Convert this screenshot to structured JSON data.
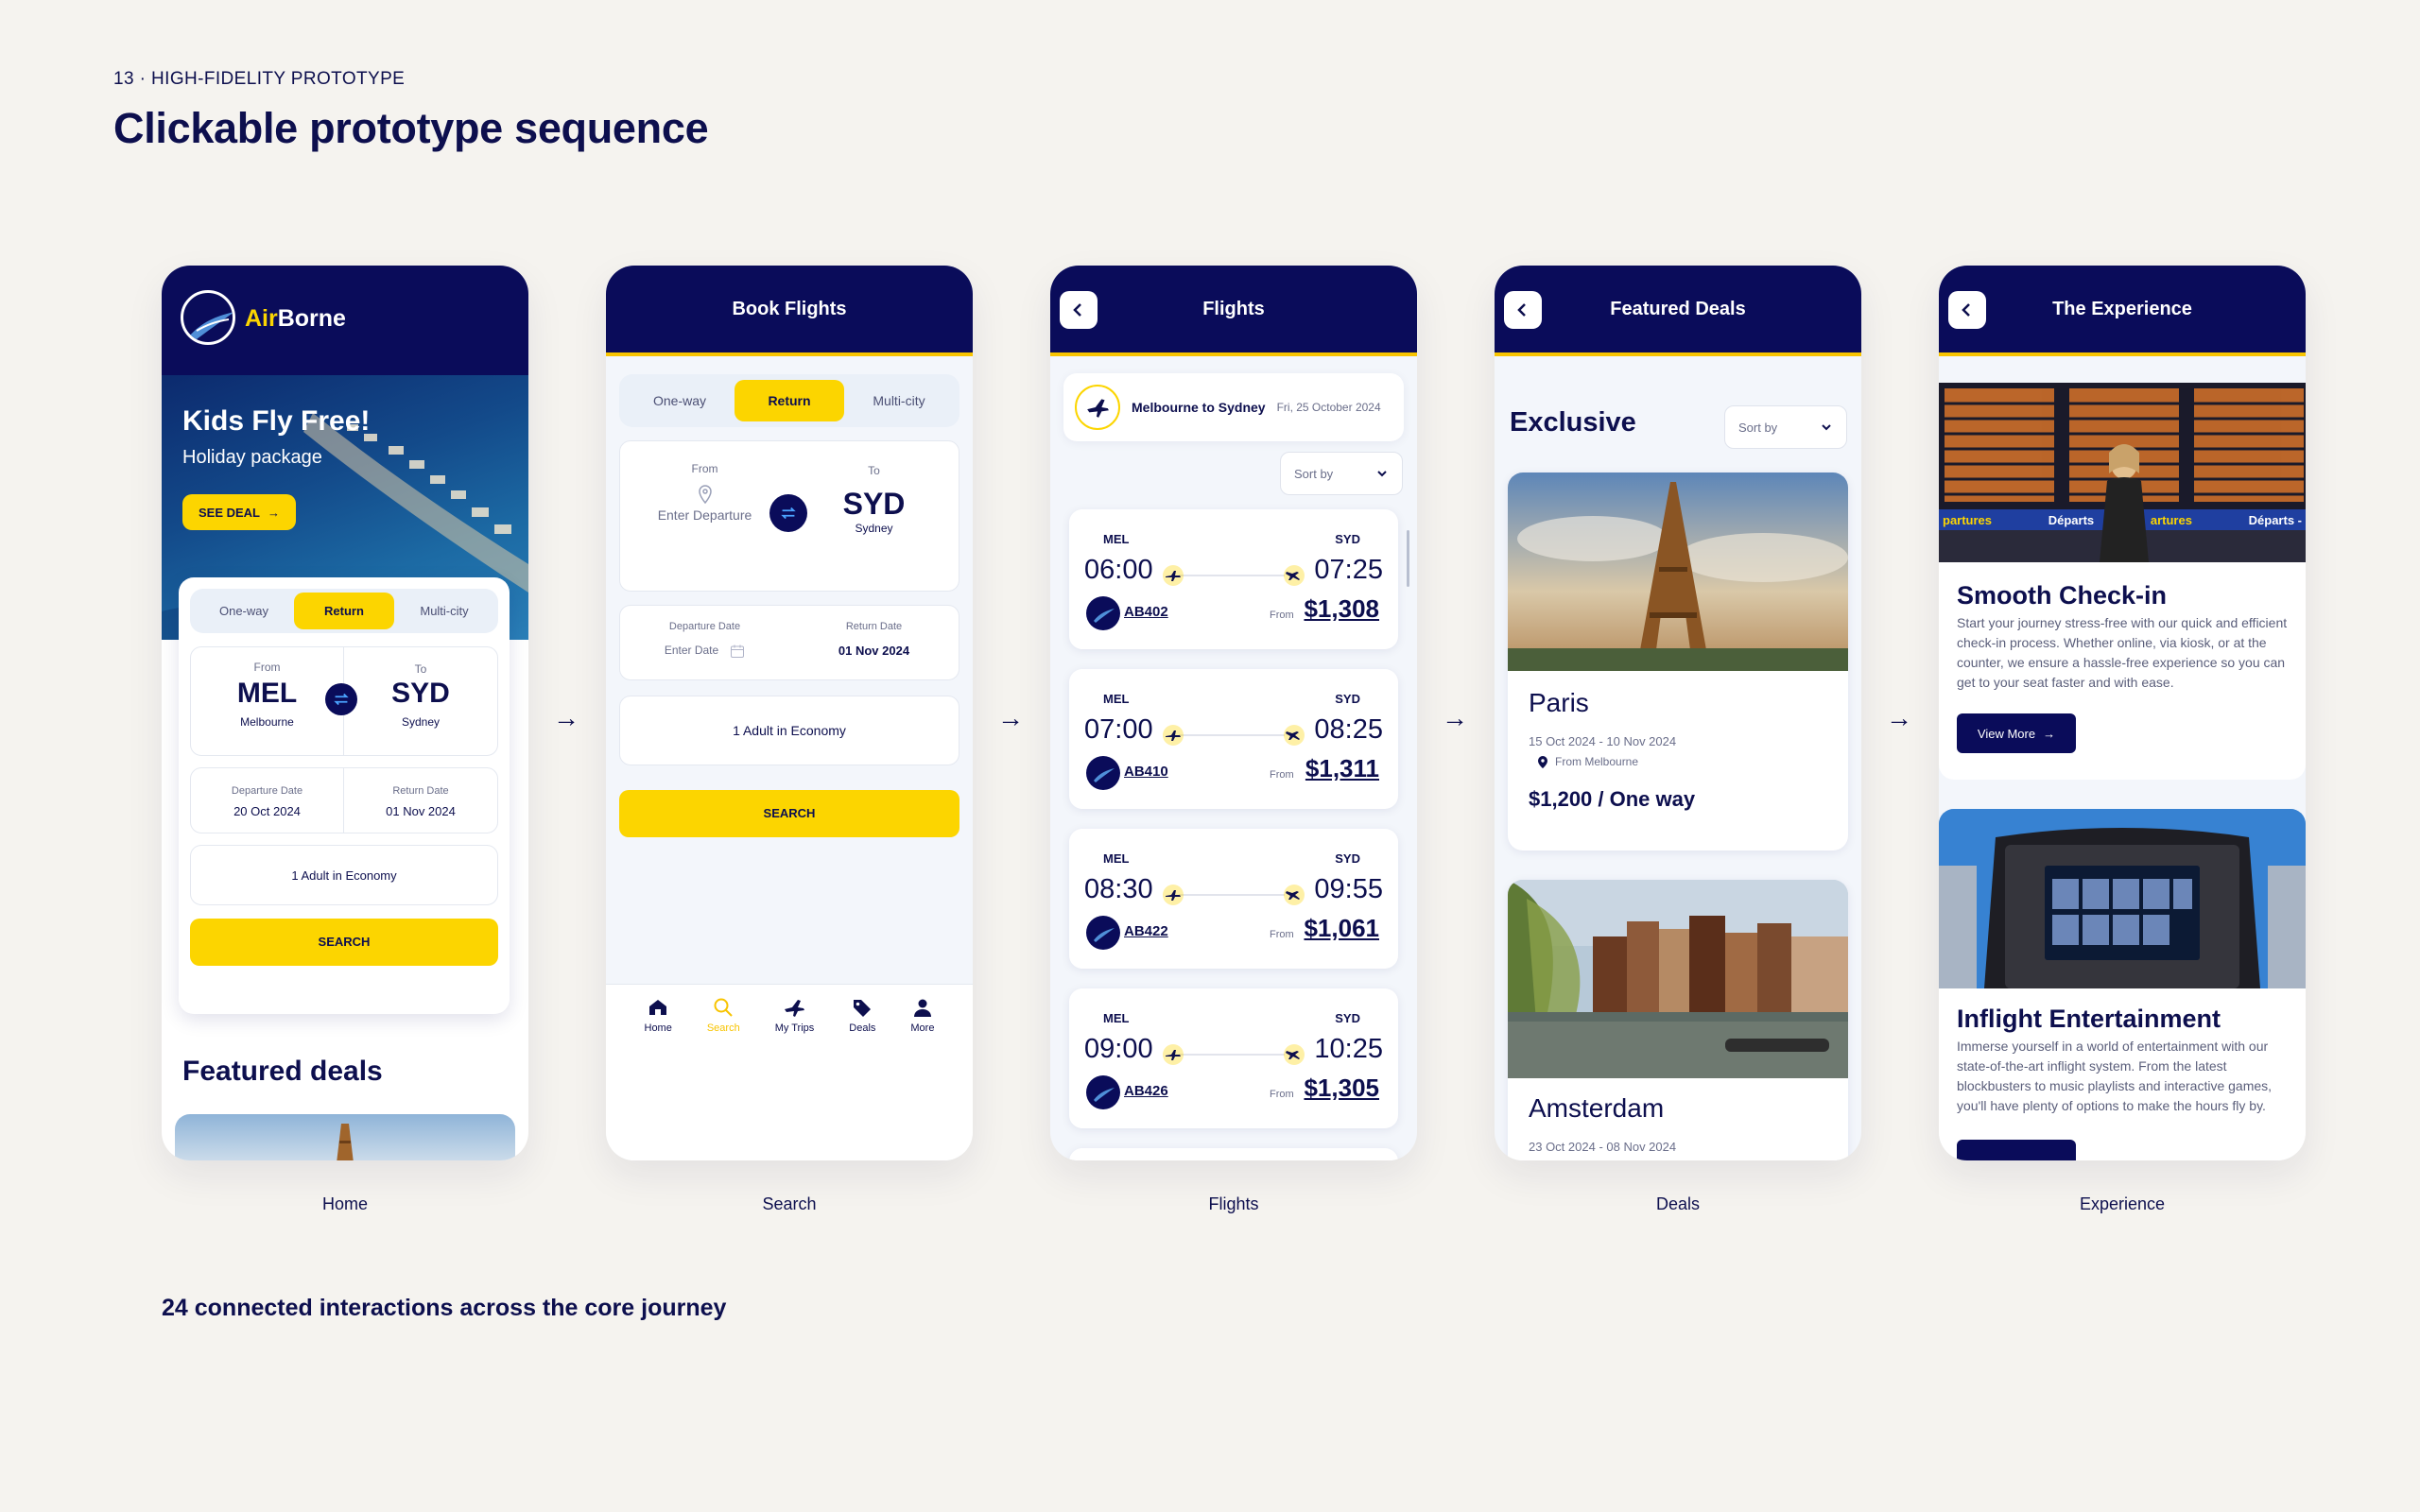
{
  "page": {
    "kicker": "13 · HIGH-FIDELITY PROTOTYPE",
    "title": "Clickable prototype sequence",
    "footnote": "24 connected interactions across the core journey",
    "arrow": "→",
    "captions": [
      "Home",
      "Search",
      "Flights",
      "Deals",
      "Experience"
    ]
  },
  "home": {
    "brand_air": "Air",
    "brand_borne": "Borne",
    "hero_title": "Kids Fly Free!",
    "hero_sub": "Holiday package",
    "deal_btn": "SEE DEAL",
    "trip_types": [
      "One-way",
      "Return",
      "Multi-city"
    ],
    "from_label": "From",
    "from_code": "MEL",
    "from_city": "Melbourne",
    "to_label": "To",
    "to_code": "SYD",
    "to_city": "Sydney",
    "dep_label": "Departure Date",
    "dep_value": "20 Oct 2024",
    "ret_label": "Return Date",
    "ret_value": "01 Nov 2024",
    "passengers": "1 Adult in Economy",
    "search_btn": "SEARCH",
    "featured": "Featured deals"
  },
  "search": {
    "header": "Book Flights",
    "trip_types": [
      "One-way",
      "Return",
      "Multi-city"
    ],
    "from_label": "From",
    "from_placeholder": "Enter Departure",
    "to_label": "To",
    "to_code": "SYD",
    "to_city": "Sydney",
    "dep_label": "Departure Date",
    "dep_placeholder": "Enter Date",
    "ret_label": "Return Date",
    "ret_value": "01 Nov 2024",
    "passengers": "1 Adult in Economy",
    "search_btn": "SEARCH",
    "nav": [
      "Home",
      "Search",
      "My Trips",
      "Deals",
      "More"
    ]
  },
  "flights": {
    "header": "Flights",
    "route": "Melbourne to Sydney",
    "date": "Fri, 25 October 2024",
    "sort": "Sort by",
    "from_word": "From",
    "list": [
      {
        "from": "MEL",
        "to": "SYD",
        "dep": "06:00",
        "arr": "07:25",
        "num": "AB402",
        "price": "$1,308"
      },
      {
        "from": "MEL",
        "to": "SYD",
        "dep": "07:00",
        "arr": "08:25",
        "num": "AB410",
        "price": "$1,311"
      },
      {
        "from": "MEL",
        "to": "SYD",
        "dep": "08:30",
        "arr": "09:55",
        "num": "AB422",
        "price": "$1,061"
      },
      {
        "from": "MEL",
        "to": "SYD",
        "dep": "09:00",
        "arr": "10:25",
        "num": "AB426",
        "price": "$1,305"
      }
    ]
  },
  "deals": {
    "header": "Featured Deals",
    "section": "Exclusive",
    "sort": "Sort by",
    "paris": {
      "city": "Paris",
      "dates": "15 Oct 2024 - 10 Nov 2024",
      "origin": "From Melbourne",
      "price": "$1,200 / One way"
    },
    "amsterdam": {
      "city": "Amsterdam",
      "dates": "23 Oct 2024 - 08 Nov 2024"
    }
  },
  "experience": {
    "header": "The Experience",
    "board_words": [
      "partures",
      "Départs",
      "artures",
      "Départs -"
    ],
    "checkin_title": "Smooth Check-in",
    "checkin_body": "Start your journey stress-free with our quick and efficient check-in process. Whether online, via kiosk, or at the counter, we ensure a hassle-free experience so you can get to your seat faster and with ease.",
    "view_more": "View More",
    "ent_title": "Inflight Entertainment",
    "ent_body": "Immerse yourself in a world of entertainment with our state-of-the-art inflight system. From the latest blockbusters to music playlists and interactive games, you'll have plenty of options to make the hours fly by."
  },
  "colors": {
    "navy": "#0a0c5a",
    "yellow": "#fcd500",
    "background": "#f5f3ef"
  }
}
